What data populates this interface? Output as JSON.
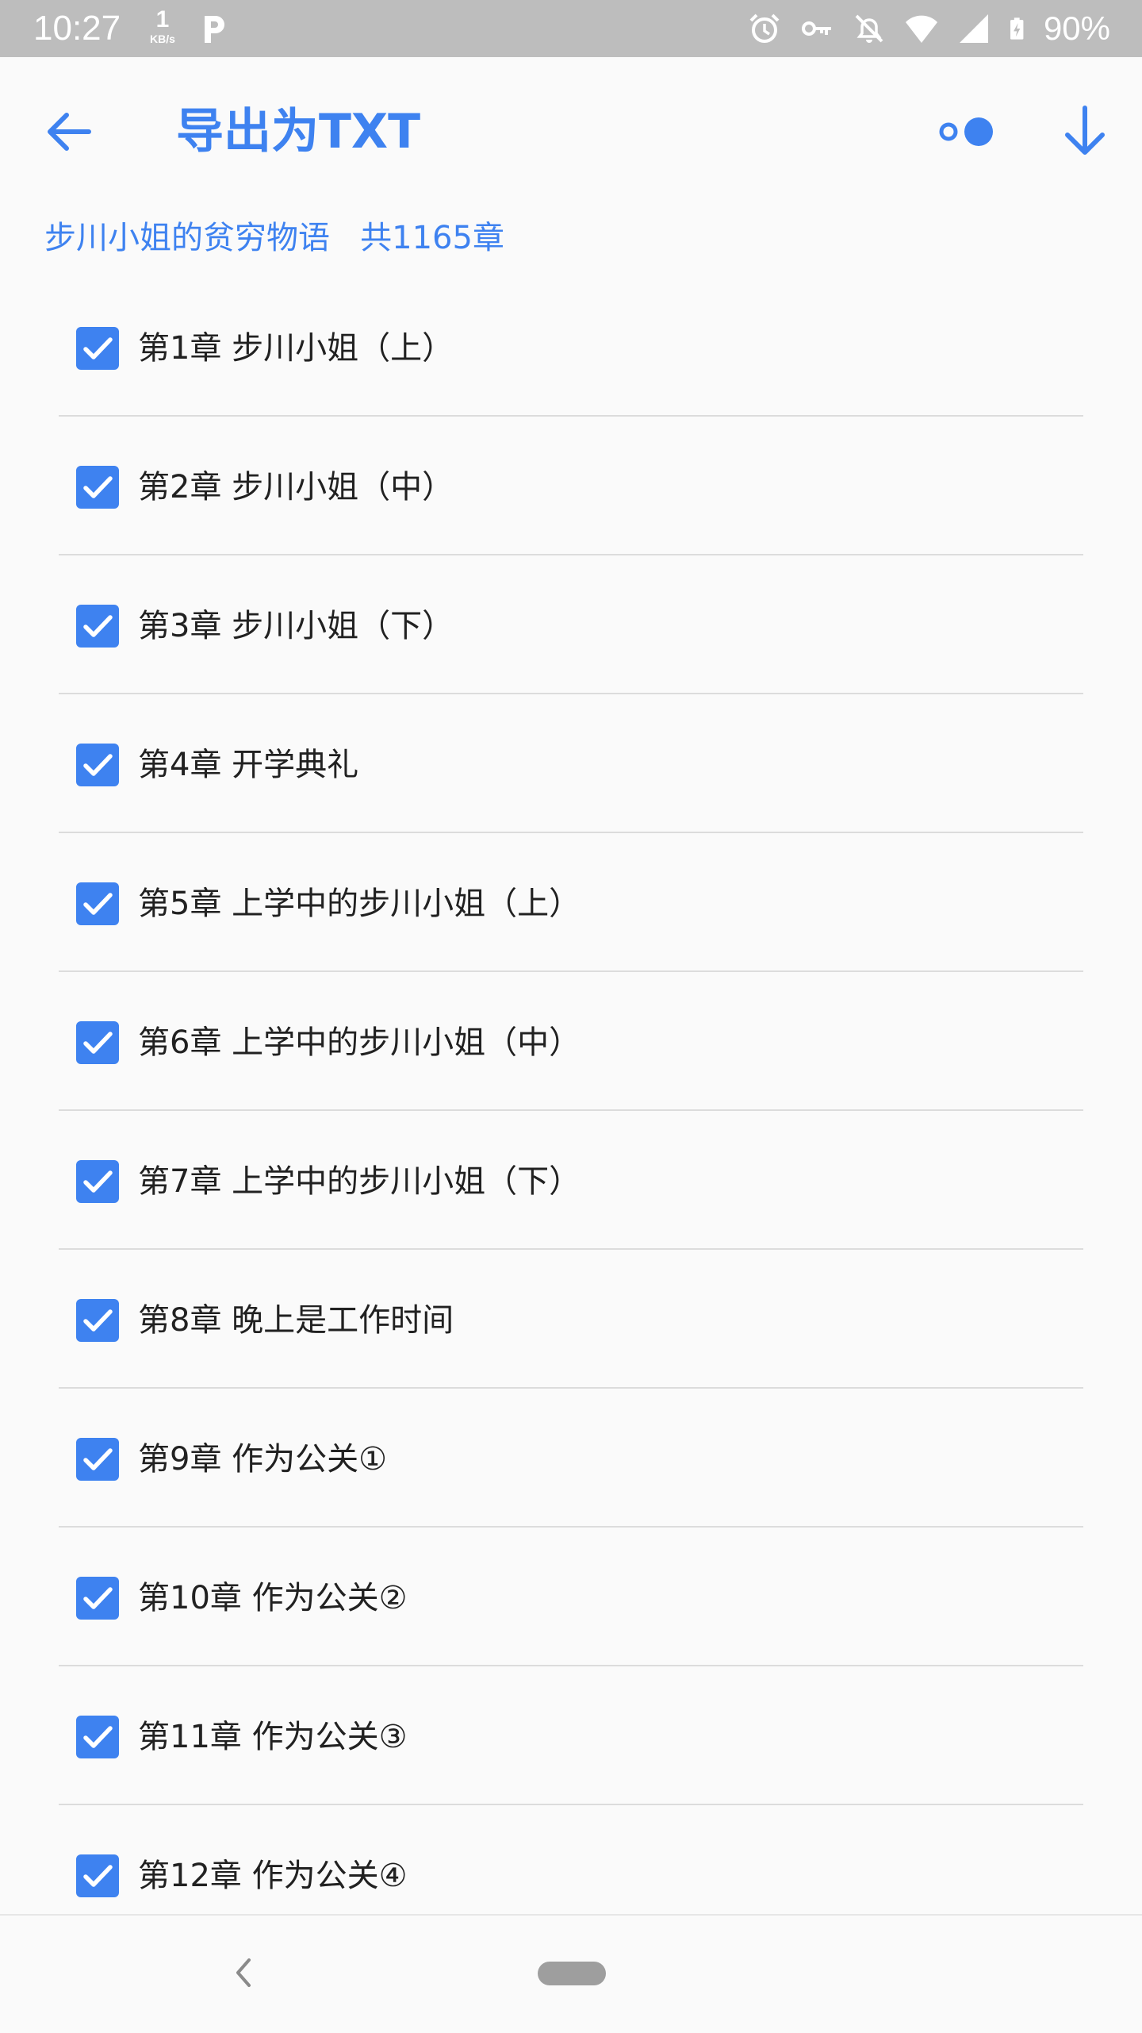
{
  "status_bar": {
    "time": "10:27",
    "speed_value": "1",
    "speed_unit": "KB/s",
    "battery": "90%"
  },
  "toolbar": {
    "title": "导出为TXT"
  },
  "book": {
    "summary": "步川小姐的贫穷物语   共1165章"
  },
  "chapters": [
    {
      "label": "第1章 步川小姐（上）",
      "checked": true
    },
    {
      "label": "第2章 步川小姐（中）",
      "checked": true
    },
    {
      "label": "第3章 步川小姐（下）",
      "checked": true
    },
    {
      "label": "第4章 开学典礼",
      "checked": true
    },
    {
      "label": "第5章 上学中的步川小姐（上）",
      "checked": true
    },
    {
      "label": "第6章 上学中的步川小姐（中）",
      "checked": true
    },
    {
      "label": "第7章 上学中的步川小姐（下）",
      "checked": true
    },
    {
      "label": "第8章 晚上是工作时间",
      "checked": true
    },
    {
      "label": "第9章 作为公关①",
      "checked": true
    },
    {
      "label": "第10章 作为公关②",
      "checked": true
    },
    {
      "label": "第11章 作为公关③",
      "checked": true
    },
    {
      "label": "第12章 作为公关④",
      "checked": true
    }
  ],
  "colors": {
    "accent": "#3e82f0",
    "status_bar_bg": "#bdbdbd"
  }
}
